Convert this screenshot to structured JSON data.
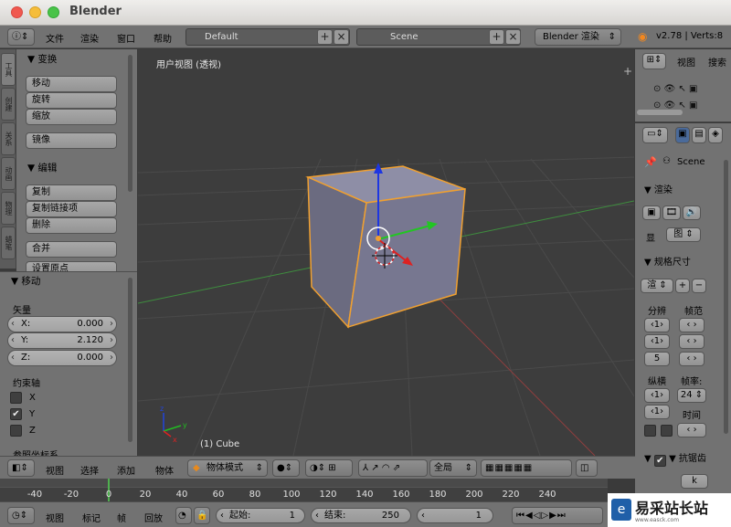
{
  "window": {
    "title": "Blender"
  },
  "topbar": {
    "menus": [
      "文件",
      "渲染",
      "窗口",
      "帮助"
    ],
    "screen_layout": "Default",
    "scene": "Scene",
    "render_engine": "Blender 渲染",
    "version": "v2.78 | Verts:8"
  },
  "left_tabs": [
    "工具",
    "创建",
    "关系",
    "动画",
    "物理",
    "蜡笔"
  ],
  "tool_shelf": {
    "transform": {
      "title": "▼ 变换",
      "buttons": [
        "移动",
        "旋转",
        "缩放",
        "镜像"
      ]
    },
    "edit": {
      "title": "▼ 编辑",
      "buttons": [
        "复制",
        "复制链接项",
        "删除",
        "合并",
        "设置原点"
      ]
    }
  },
  "redo_panel": {
    "title": "▼ 移动",
    "vector_label": "矢量",
    "vector": [
      {
        "axis": "X:",
        "value": "0.000"
      },
      {
        "axis": "Y:",
        "value": "2.120"
      },
      {
        "axis": "Z:",
        "value": "0.000"
      }
    ],
    "constraint_label": "约束轴",
    "constraints": [
      {
        "axis": "X",
        "checked": false
      },
      {
        "axis": "Y",
        "checked": true
      },
      {
        "axis": "Z",
        "checked": false
      }
    ],
    "orientation_label": "参照坐标系"
  },
  "viewport": {
    "view_label": "用户视图 (透视)",
    "object_label": "(1) Cube"
  },
  "outliner": {
    "view": "视图",
    "search": "搜索"
  },
  "properties": {
    "scene_label": "Scene",
    "render_panel": "▼ 渲染",
    "display_label": "显",
    "display_value": "图",
    "dimensions_panel": "▼ 规格尺寸",
    "preset": "渲",
    "resolution_label": "分辨",
    "frame_range_label": "帧范",
    "resolution_value": "5",
    "aspect_label": "纵横",
    "fps_label": "帧率:",
    "fps_value": "24",
    "time_label": "时间",
    "aa_panel": "▼ 抗锯齿",
    "aa_value": "k"
  },
  "viewport_header": {
    "menus": [
      "视图",
      "选择",
      "添加",
      "物体"
    ],
    "mode": "物体模式",
    "orientation": "全局"
  },
  "timeline": {
    "ticks": [
      "-40",
      "-20",
      "0",
      "20",
      "40",
      "60",
      "80",
      "100",
      "120",
      "140",
      "160",
      "180",
      "200",
      "220",
      "240"
    ],
    "current_frame": 1
  },
  "timeline_header": {
    "menus": [
      "视图",
      "标记",
      "帧",
      "回放"
    ],
    "start_label": "起始:",
    "start_value": "1",
    "end_label": "结束:",
    "end_value": "250",
    "current_value": "1"
  },
  "watermark": {
    "text": "易采站长站",
    "url": "www.easck.com"
  },
  "colors": {
    "accent_selected": "#f0a030",
    "axis_x": "#c22",
    "axis_y": "#2b2",
    "axis_z": "#22c"
  }
}
